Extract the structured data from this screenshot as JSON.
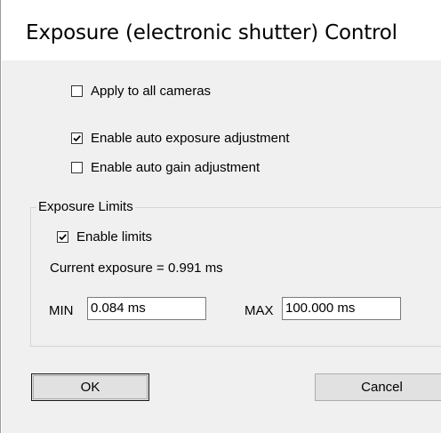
{
  "window": {
    "title": "Exposure (electronic shutter) Control"
  },
  "options": {
    "apply_all": {
      "label": "Apply to all cameras",
      "checked": false
    },
    "auto_exposure": {
      "label": "Enable auto exposure adjustment",
      "checked": true
    },
    "auto_gain": {
      "label": "Enable auto gain adjustment",
      "checked": false
    }
  },
  "limits": {
    "group_label": "Exposure Limits",
    "enable_label": "Enable limits",
    "enable_checked": true,
    "current_exposure_text": "Current exposure = 0.991 ms",
    "min_label": "MIN",
    "min_value": "0.084 ms",
    "max_label": "MAX",
    "max_value": "100.000 ms"
  },
  "buttons": {
    "ok_label": "OK",
    "cancel_label": "Cancel"
  }
}
